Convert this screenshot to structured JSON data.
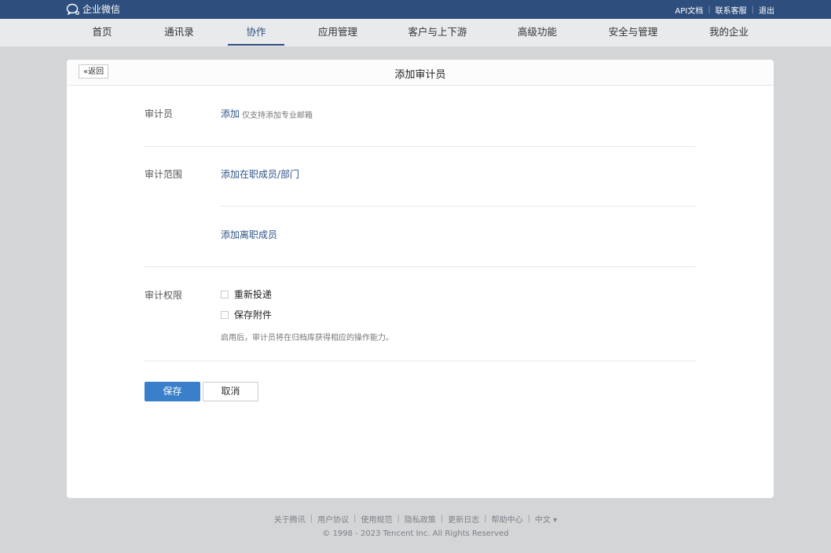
{
  "topbar": {
    "brand": "企业微信",
    "links": [
      "API文档",
      "联系客服",
      "退出"
    ]
  },
  "nav": {
    "items": [
      "首页",
      "通讯录",
      "协作",
      "应用管理",
      "客户与上下游",
      "高级功能",
      "安全与管理",
      "我的企业"
    ],
    "active": "协作"
  },
  "page": {
    "back_label": "«返回",
    "title": "添加审计员"
  },
  "form": {
    "auditor": {
      "label": "审计员",
      "add_link": "添加",
      "hint": "仅支持添加专业邮箱"
    },
    "scope": {
      "label": "审计范围",
      "add_active": "添加在职成员/部门",
      "add_departed": "添加离职成员"
    },
    "permission": {
      "label": "审计权限",
      "options": [
        {
          "label": "重新投递",
          "checked": false
        },
        {
          "label": "保存附件",
          "checked": false
        }
      ],
      "hint": "启用后，审计员将在归档库获得相应的操作能力。"
    },
    "save_label": "保存",
    "cancel_label": "取消"
  },
  "footer": {
    "links": [
      "关于腾讯",
      "用户协议",
      "使用规范",
      "隐私政策",
      "更新日志",
      "帮助中心"
    ],
    "language": "中文 ▾",
    "copyright": "© 1998 - 2023 Tencent Inc. All Rights Reserved"
  }
}
